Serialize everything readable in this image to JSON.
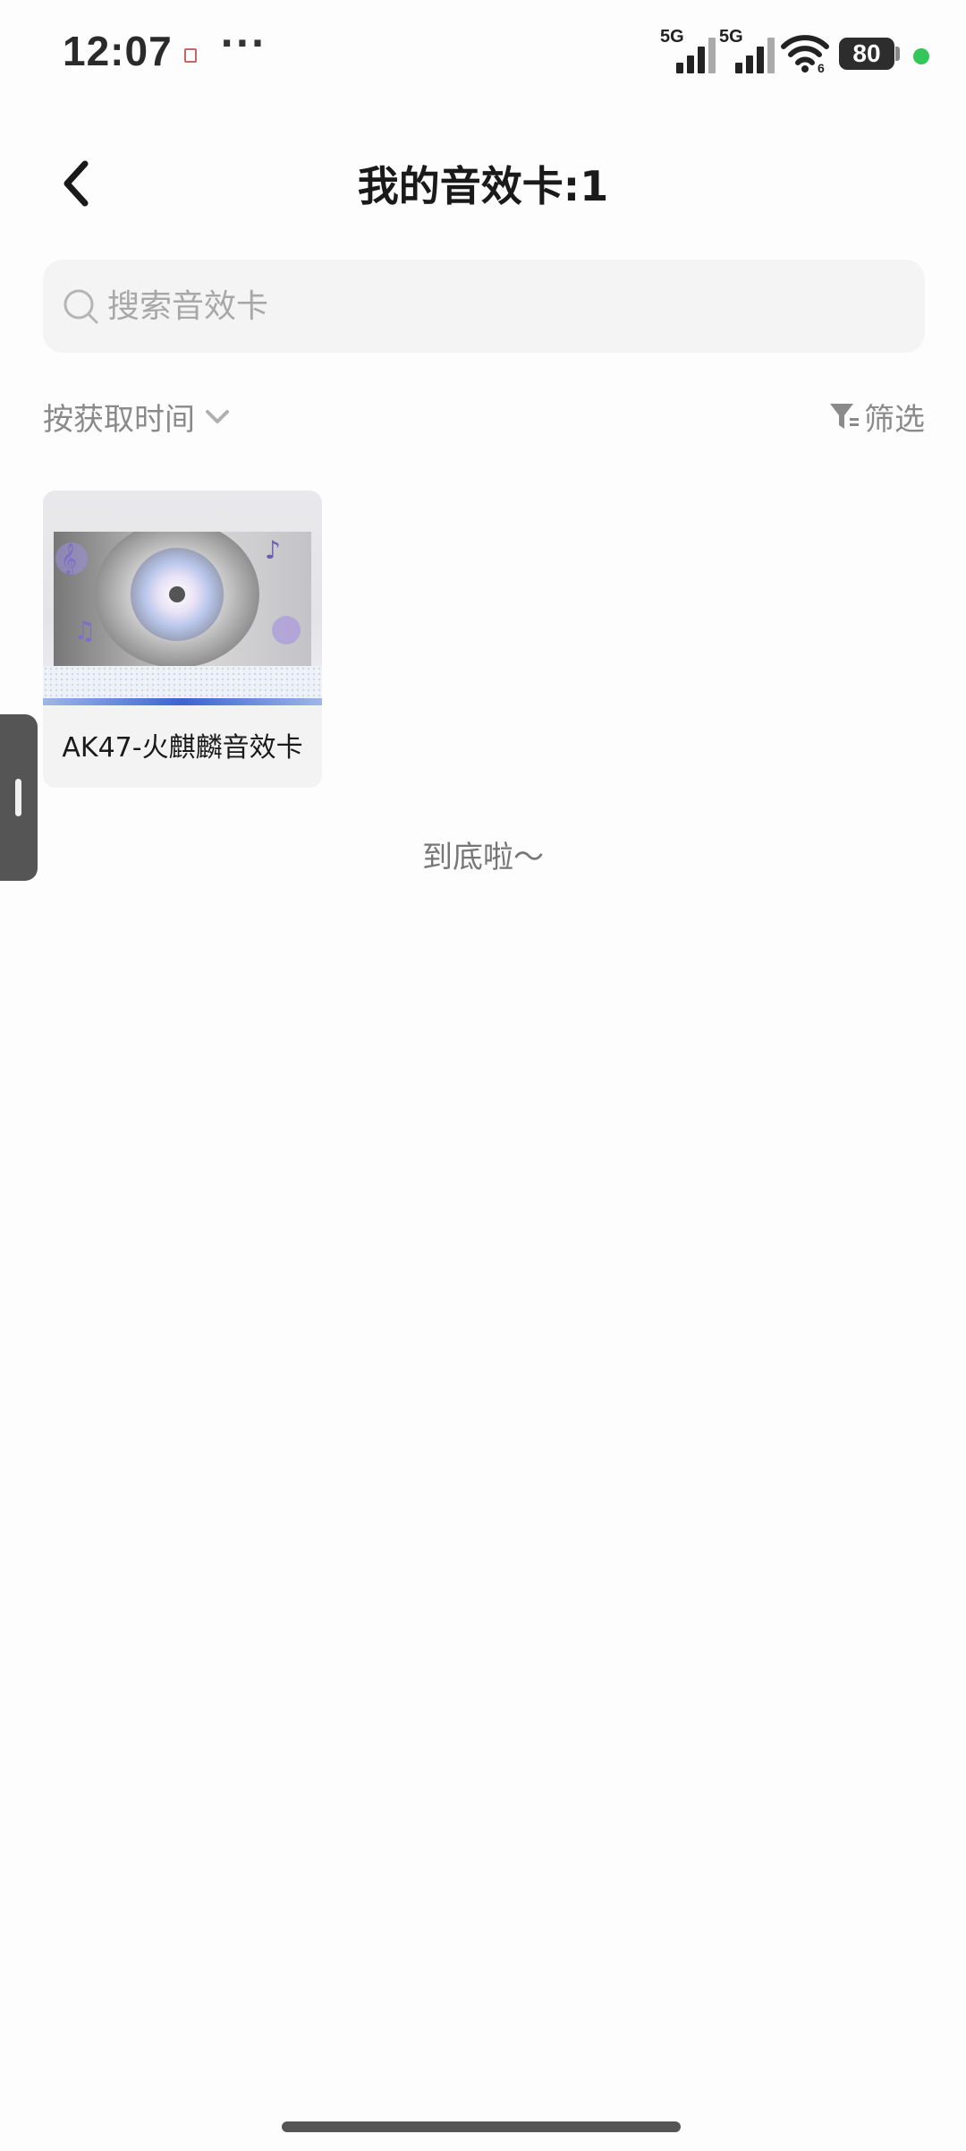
{
  "status_bar": {
    "time": "12:07",
    "more": "···",
    "sim1_label": "5G",
    "sim2_label": "5G",
    "battery": "80",
    "wifi_label": "6"
  },
  "header": {
    "title": "我的音效卡:1"
  },
  "search": {
    "placeholder": "搜索音效卡",
    "value": ""
  },
  "sort": {
    "label": "按获取时间"
  },
  "filter": {
    "label": "筛选"
  },
  "cards": [
    {
      "name": "AK47-火麒麟音效卡"
    }
  ],
  "list_end_text": "到底啦～",
  "colors": {
    "accent_blue": "#3a64d0",
    "status_green": "#33c759",
    "muted_text": "#8a8a8a"
  }
}
